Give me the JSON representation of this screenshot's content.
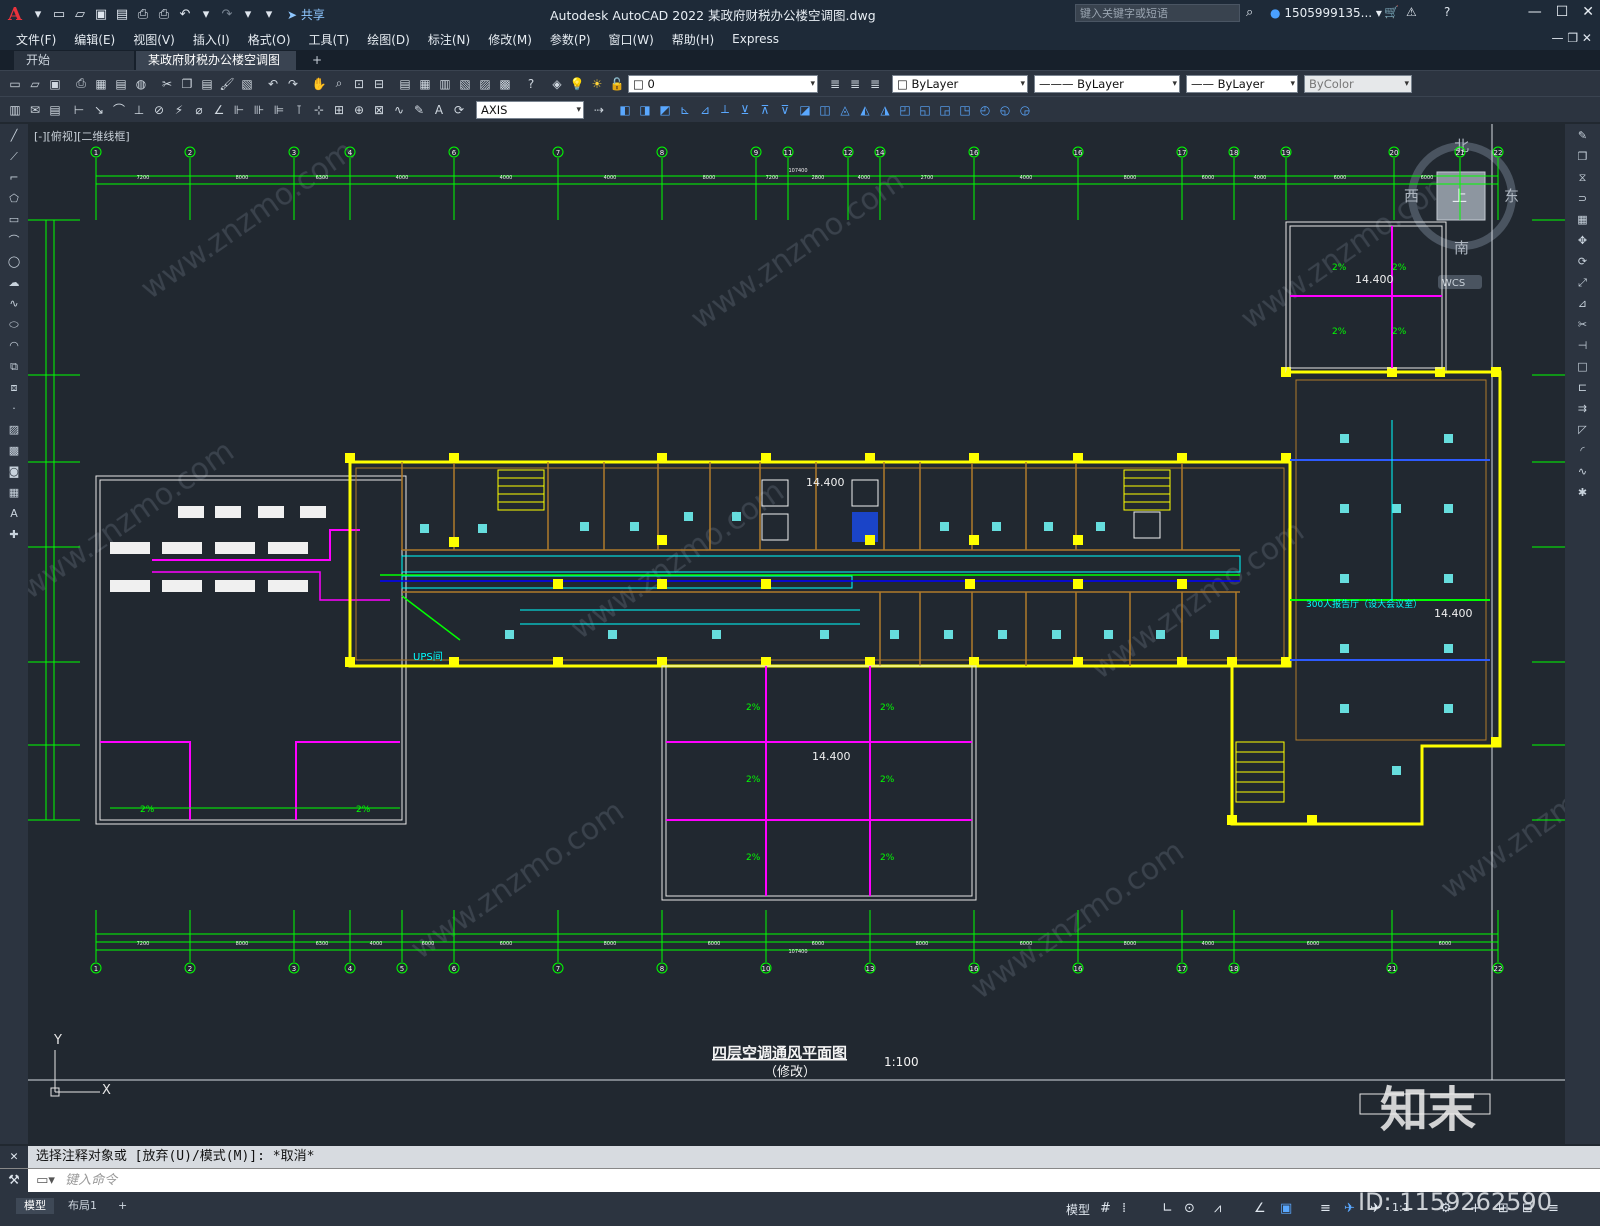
{
  "app": {
    "title": "Autodesk AutoCAD 2022    某政府财税办公楼空调图.dwg",
    "share": "共享",
    "search_placeholder": "键入关键字或短语",
    "user": "1505999135...",
    "logo": "A"
  },
  "menu": [
    "文件(F)",
    "编辑(E)",
    "视图(V)",
    "插入(I)",
    "格式(O)",
    "工具(T)",
    "绘图(D)",
    "标注(N)",
    "修改(M)",
    "参数(P)",
    "窗口(W)",
    "帮助(H)",
    "Express"
  ],
  "tabs": {
    "start": "开始",
    "active": "某政府财税办公楼空调图*",
    "add": "+"
  },
  "toolbar": {
    "layer_value": "0",
    "color_value": "ByLayer",
    "linetype_value": "ByLayer",
    "lineweight_value": "ByLayer",
    "plotstyle_value": "ByColor",
    "dimstyle_value": "AXIS"
  },
  "viewport": {
    "label": "[-][俯视][二维线框]"
  },
  "viewcube": {
    "north": "北",
    "south": "南",
    "east": "东",
    "west": "西",
    "top": "上",
    "wcs": "WCS"
  },
  "drawing": {
    "title": "四层空调通风平面图",
    "subtitle": "（修改）",
    "scale": "1:100",
    "elevation_labels": [
      "14.400",
      "14.400",
      "14.400",
      "14.400"
    ],
    "room_label": "300人报告厅（设大会议室）",
    "ups_label": "UPS间",
    "slope_label": "2%",
    "grid_top": [
      "1",
      "2",
      "3",
      "4",
      "6",
      "7",
      "8",
      "9",
      "11",
      "12",
      "14",
      "16",
      "16",
      "17",
      "18",
      "19",
      "20",
      "21",
      "22"
    ],
    "grid_bottom": [
      "1",
      "2",
      "3",
      "4",
      "5",
      "6",
      "7",
      "8",
      "10",
      "13",
      "16",
      "16",
      "17",
      "18",
      "21",
      "22"
    ],
    "dims_top": [
      "7200",
      "8000",
      "6300",
      "4000",
      "4000",
      "4000",
      "8000",
      "7200",
      "2800",
      "4000",
      "2700",
      "4000",
      "8000",
      "6000",
      "4000",
      "6000",
      "6000"
    ],
    "dims_bottom": [
      "7200",
      "8000",
      "6300",
      "4000",
      "6000",
      "6000",
      "8000",
      "6000",
      "6000",
      "8000",
      "6000",
      "8000",
      "4000",
      "6000",
      "6000"
    ],
    "overall_dim": "107400"
  },
  "watermark": {
    "text": "www.znzmo.com",
    "logo": "知末",
    "id": "ID: 1159262590"
  },
  "ucs": {
    "x": "X",
    "y": "Y"
  },
  "command": {
    "history": "选择注释对象或 [放弃(U)/模式(M)]: *取消*",
    "placeholder": "键入命令"
  },
  "status": {
    "model_tab": "模型",
    "layout_tab": "布局1",
    "add": "+",
    "model_btn": "模型",
    "scale": "1:1"
  }
}
